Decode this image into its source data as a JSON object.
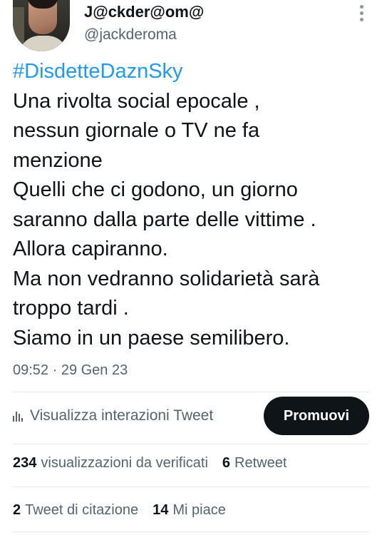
{
  "author": {
    "display_name": "J@ckder@om@",
    "handle": "@jackderoma"
  },
  "tweet": {
    "hashtag": "#DisdetteDaznSky",
    "lines": [
      "Una rivolta social epocale ,",
      "nessun giornale o TV ne fa",
      "menzione",
      "Quelli che ci godono, un giorno",
      "saranno dalla parte delle vittime .",
      "Allora capiranno.",
      "Ma non vedranno solidarietà  sarà",
      "troppo tardi .",
      "Siamo in un paese semilibero."
    ],
    "timestamp": "09:52 · 29 Gen 23"
  },
  "analytics": {
    "label": "Visualizza interazioni Tweet",
    "icon": "bar-chart-icon"
  },
  "promote_button": {
    "label": "Promuovi"
  },
  "stats": {
    "views": {
      "count": "234",
      "label": "visualizzazioni da verificati"
    },
    "retweets": {
      "count": "6",
      "label": "Retweet"
    },
    "quotes": {
      "count": "2",
      "label": "Tweet di citazione"
    },
    "likes": {
      "count": "14",
      "label": "Mi piace"
    }
  },
  "colors": {
    "hashtag": "#1d9bf0",
    "text_primary": "#0f1419",
    "text_secondary": "#536471",
    "button_bg": "#0f1419",
    "divider": "#e6ecf0"
  },
  "icons": {
    "more": "more-vertical-icon",
    "avatar": "avatar"
  }
}
